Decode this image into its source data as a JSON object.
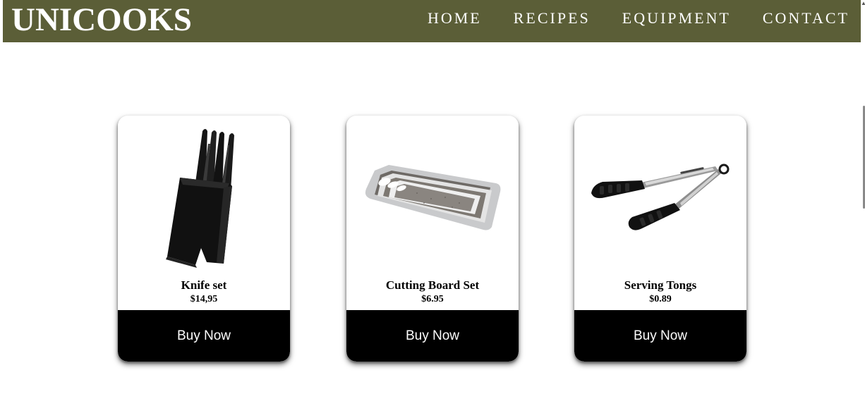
{
  "header": {
    "logo": "UNICOOKS",
    "nav": [
      {
        "label": "HOME"
      },
      {
        "label": "RECIPES"
      },
      {
        "label": "EQUIPMENT"
      },
      {
        "label": "CONTACT"
      }
    ]
  },
  "products": [
    {
      "name": "Knife set",
      "price": "$14,95",
      "button": "Buy Now",
      "image_icon": "knife-block-icon"
    },
    {
      "name": "Cutting Board Set",
      "price": "$6.95",
      "button": "Buy Now",
      "image_icon": "cutting-board-icon"
    },
    {
      "name": "Serving Tongs",
      "price": "$0.89",
      "button": "Buy Now",
      "image_icon": "tongs-icon"
    }
  ],
  "colors": {
    "navbar": "#5b5e37",
    "button": "#000000",
    "button_text": "#ffffff"
  }
}
